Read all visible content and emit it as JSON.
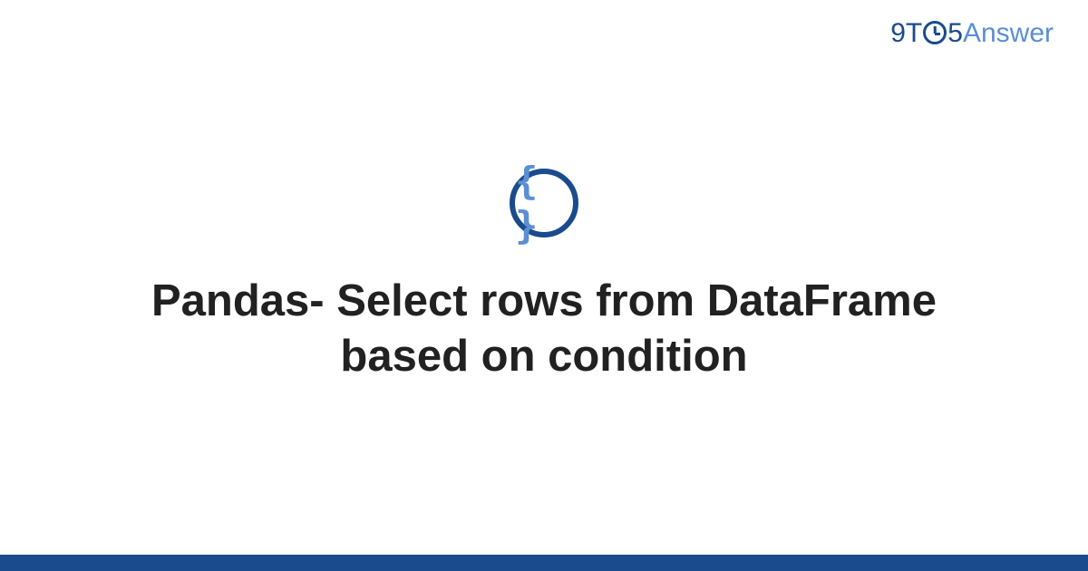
{
  "header": {
    "logo_9t": "9T",
    "logo_5": "5",
    "logo_answer": "Answer"
  },
  "main": {
    "icon_braces": "{ }",
    "title": "Pandas- Select rows from DataFrame based on condition"
  },
  "colors": {
    "primary": "#1a4b8c",
    "accent": "#5a8fd4",
    "text": "#212121"
  }
}
